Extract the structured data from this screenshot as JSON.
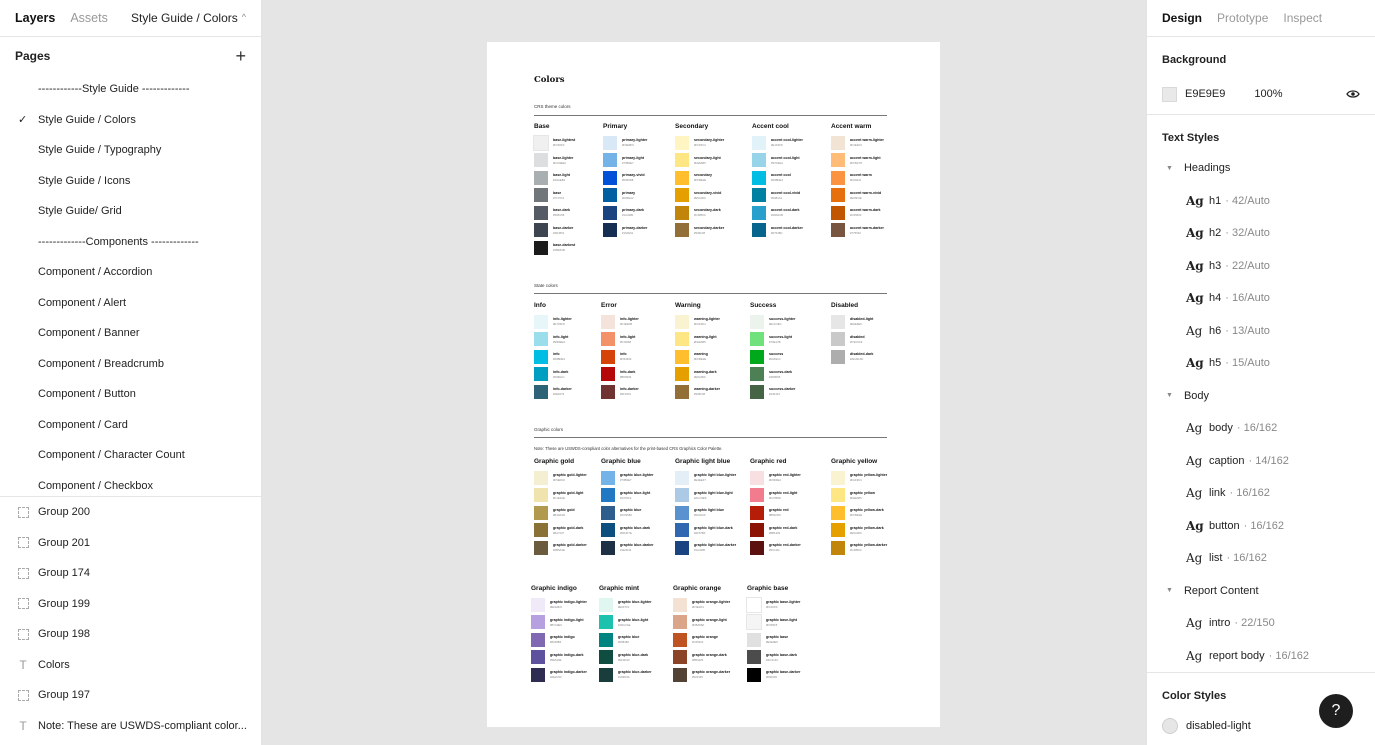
{
  "left_panel": {
    "tabs": [
      "Layers",
      "Assets"
    ],
    "file_breadcrumb": "Style Guide / Colors",
    "pages_heading": "Pages",
    "pages": [
      {
        "label": "------------Style Guide -------------",
        "selected": false
      },
      {
        "label": "Style Guide / Colors",
        "selected": true
      },
      {
        "label": "Style Guide / Typography",
        "selected": false
      },
      {
        "label": "Style Guide / Icons",
        "selected": false
      },
      {
        "label": "Style Guide/ Grid",
        "selected": false
      },
      {
        "label": "-------------Components -------------",
        "selected": false
      },
      {
        "label": "Component / Accordion",
        "selected": false
      },
      {
        "label": "Component / Alert",
        "selected": false
      },
      {
        "label": "Component / Banner",
        "selected": false
      },
      {
        "label": "Component / Breadcrumb",
        "selected": false
      },
      {
        "label": "Component / Button",
        "selected": false
      },
      {
        "label": "Component / Card",
        "selected": false
      },
      {
        "label": "Component / Character Count",
        "selected": false
      },
      {
        "label": "Component / Checkbox",
        "selected": false
      }
    ],
    "layers": [
      {
        "label": "Group 200",
        "kind": "group"
      },
      {
        "label": "Group 201",
        "kind": "group"
      },
      {
        "label": "Group 174",
        "kind": "group"
      },
      {
        "label": "Group 199",
        "kind": "group"
      },
      {
        "label": "Group 198",
        "kind": "group"
      },
      {
        "label": "Colors",
        "kind": "text"
      },
      {
        "label": "Group 197",
        "kind": "group"
      },
      {
        "label": "Note: These are USWDS-compliant color...",
        "kind": "text"
      }
    ]
  },
  "frame": {
    "title": "Colors",
    "sections": [
      {
        "label": "CRS theme colors"
      },
      {
        "label": "State colors"
      },
      {
        "label": "Graphic colors"
      }
    ],
    "note": "Note: These are USWDS-compliant color alternatives for the print-based CRS Graphics Color Palette.",
    "groups": [
      {
        "title": "Base",
        "section": 0,
        "swatches": [
          {
            "name": "base-lightest",
            "hex": "#F0F0F0",
            "color": "#f0f0f0"
          },
          {
            "name": "base-lighter",
            "hex": "#DCDEE0",
            "color": "#dcdee0"
          },
          {
            "name": "base-light",
            "hex": "#A9AEB1",
            "color": "#a9aeb1"
          },
          {
            "name": "base",
            "hex": "#71767A",
            "color": "#71767a"
          },
          {
            "name": "base-dark",
            "hex": "#565C65",
            "color": "#565c65"
          },
          {
            "name": "base-darker",
            "hex": "#3D4551",
            "color": "#3d4551"
          },
          {
            "name": "base-darkest",
            "hex": "#1B1B1B",
            "color": "#1b1b1b"
          }
        ]
      },
      {
        "title": "Primary",
        "section": 0,
        "swatches": [
          {
            "name": "primary-lighter",
            "hex": "#D9E8F6",
            "color": "#d9e8f6"
          },
          {
            "name": "primary-light",
            "hex": "#73B3E7",
            "color": "#73b3e7"
          },
          {
            "name": "primary-vivid",
            "hex": "#0050D8",
            "color": "#0050d8"
          },
          {
            "name": "primary",
            "hex": "#005EA2",
            "color": "#005ea2"
          },
          {
            "name": "primary-dark",
            "hex": "#1A4480",
            "color": "#1a4480"
          },
          {
            "name": "primary-darker",
            "hex": "#162E51",
            "color": "#162e51"
          }
        ]
      },
      {
        "title": "Secondary",
        "section": 0,
        "swatches": [
          {
            "name": "secondary-lighter",
            "hex": "#FFF5C2",
            "color": "#fff5c2"
          },
          {
            "name": "secondary-light",
            "hex": "#FEE685",
            "color": "#fee685"
          },
          {
            "name": "secondary",
            "hex": "#FFBE2E",
            "color": "#ffbe2e"
          },
          {
            "name": "secondary-vivid",
            "hex": "#E5A000",
            "color": "#e5a000"
          },
          {
            "name": "secondary-dark",
            "hex": "#C2850C",
            "color": "#c2850c"
          },
          {
            "name": "secondary-darker",
            "hex": "#936F38",
            "color": "#936f38"
          }
        ]
      },
      {
        "title": "Accent cool",
        "section": 0,
        "swatches": [
          {
            "name": "accent cool-lighter",
            "hex": "#E1F3F8",
            "color": "#e1f3f8"
          },
          {
            "name": "accent cool-light",
            "hex": "#97D4EA",
            "color": "#97d4ea"
          },
          {
            "name": "accent cool",
            "hex": "#00BDE3",
            "color": "#00bde3"
          },
          {
            "name": "accent cool-vivid",
            "hex": "#0081A1",
            "color": "#0081a1"
          },
          {
            "name": "accent cool-dark",
            "hex": "#28A0CB",
            "color": "#28a0cb"
          },
          {
            "name": "accent cool-darker",
            "hex": "#07648D",
            "color": "#07648d"
          }
        ]
      },
      {
        "title": "Accent warm",
        "section": 0,
        "swatches": [
          {
            "name": "accent warm-lighter",
            "hex": "#F2E4D4",
            "color": "#f2e4d4"
          },
          {
            "name": "accent warm-light",
            "hex": "#FFBC78",
            "color": "#ffbc78"
          },
          {
            "name": "accent warm",
            "hex": "#FA9441",
            "color": "#fa9441"
          },
          {
            "name": "accent warm-vivid",
            "hex": "#E66F0E",
            "color": "#e66f0e"
          },
          {
            "name": "accent warm-dark",
            "hex": "#C05600",
            "color": "#c05600"
          },
          {
            "name": "accent warm-darker",
            "hex": "#775540",
            "color": "#775540"
          }
        ]
      },
      {
        "title": "Info",
        "section": 1,
        "swatches": [
          {
            "name": "info-lighter",
            "hex": "#E7F6F8",
            "color": "#e7f6f8"
          },
          {
            "name": "info-light",
            "hex": "#99DEEA",
            "color": "#99deea"
          },
          {
            "name": "info",
            "hex": "#00BDE3",
            "color": "#00bde3"
          },
          {
            "name": "info-dark",
            "hex": "#009EC1",
            "color": "#009ec1"
          },
          {
            "name": "info-darker",
            "hex": "#2E6276",
            "color": "#2e6276"
          }
        ]
      },
      {
        "title": "Error",
        "section": 1,
        "swatches": [
          {
            "name": "info-lighter",
            "hex": "#F4E3DB",
            "color": "#f4e3db"
          },
          {
            "name": "info-light",
            "hex": "#F39268",
            "color": "#f39268"
          },
          {
            "name": "info",
            "hex": "#D54309",
            "color": "#d54309"
          },
          {
            "name": "info-dark",
            "hex": "#B50909",
            "color": "#b50909"
          },
          {
            "name": "info-darker",
            "hex": "#6F3331",
            "color": "#6f3331"
          }
        ]
      },
      {
        "title": "Warning",
        "section": 1,
        "swatches": [
          {
            "name": "warning-lighter",
            "hex": "#FAF3D1",
            "color": "#faf3d1"
          },
          {
            "name": "warning-light",
            "hex": "#FEE685",
            "color": "#fee685"
          },
          {
            "name": "warning",
            "hex": "#FFBE2E",
            "color": "#ffbe2e"
          },
          {
            "name": "warning-dark",
            "hex": "#E5A000",
            "color": "#e5a000"
          },
          {
            "name": "warning-darker",
            "hex": "#936F38",
            "color": "#936f38"
          }
        ]
      },
      {
        "title": "Success",
        "section": 1,
        "swatches": [
          {
            "name": "success-lighter",
            "hex": "#ECF3EC",
            "color": "#ecf3ec"
          },
          {
            "name": "success-light",
            "hex": "#70E17B",
            "color": "#70e17b"
          },
          {
            "name": "success",
            "hex": "#00A91C",
            "color": "#00a91c"
          },
          {
            "name": "success-dark",
            "hex": "#4D8055",
            "color": "#4d8055"
          },
          {
            "name": "success-darker",
            "hex": "#446443",
            "color": "#446443"
          }
        ]
      },
      {
        "title": "Disabled",
        "section": 1,
        "swatches": [
          {
            "name": "disabled-light",
            "hex": "#E6E6E6",
            "color": "#e6e6e6"
          },
          {
            "name": "disabled",
            "hex": "#C9C9C9",
            "color": "#c9c9c9"
          },
          {
            "name": "disabled-dark",
            "hex": "#ADADAD",
            "color": "#adadad"
          }
        ]
      },
      {
        "title": "Graphic gold",
        "section": 2,
        "swatches": [
          {
            "name": "graphic gold-lighter",
            "hex": "#F5EFD2",
            "color": "#f5efd2"
          },
          {
            "name": "graphic gold-light",
            "hex": "#F1E3AE",
            "color": "#f1e3ae"
          },
          {
            "name": "graphic gold",
            "hex": "#B19A4D",
            "color": "#b19a4d"
          },
          {
            "name": "graphic gold-dark",
            "hex": "#8A7237",
            "color": "#8a7237"
          },
          {
            "name": "graphic gold-darker",
            "hex": "#6B5A3E",
            "color": "#6b5a3e"
          }
        ]
      },
      {
        "title": "Graphic blue",
        "section": 2,
        "swatches": [
          {
            "name": "graphic blue-lighter",
            "hex": "#73B3E7",
            "color": "#73b3e7"
          },
          {
            "name": "graphic blue-light",
            "hex": "#2378C3",
            "color": "#2378c3"
          },
          {
            "name": "graphic blue",
            "hex": "#2C5D8C",
            "color": "#2c5d8c"
          },
          {
            "name": "graphic blue-dark",
            "hex": "#0D4F7E",
            "color": "#0d4f7e"
          },
          {
            "name": "graphic blue-darker",
            "hex": "#1E3044",
            "color": "#1e3044"
          }
        ]
      },
      {
        "title": "Graphic light blue",
        "section": 2,
        "swatches": [
          {
            "name": "graphic light blue-lighter",
            "hex": "#E3EEF7",
            "color": "#e3eef7"
          },
          {
            "name": "graphic light blue-light",
            "hex": "#ACC9E6",
            "color": "#acc9e6"
          },
          {
            "name": "graphic light blue",
            "hex": "#5A91CF",
            "color": "#5a91cf"
          },
          {
            "name": "graphic light blue-dark",
            "hex": "#2F67B0",
            "color": "#2f67b0"
          },
          {
            "name": "graphic light blue-darker",
            "hex": "#1A4480",
            "color": "#1a4480"
          }
        ]
      },
      {
        "title": "Graphic red",
        "section": 2,
        "swatches": [
          {
            "name": "graphic red-lighter",
            "hex": "#F8DFE2",
            "color": "#f8dfe2"
          },
          {
            "name": "graphic red-light",
            "hex": "#F27B8D",
            "color": "#f27b8d"
          },
          {
            "name": "graphic red",
            "hex": "#B51D09",
            "color": "#b51d09"
          },
          {
            "name": "graphic red-dark",
            "hex": "#8B1303",
            "color": "#8b1303"
          },
          {
            "name": "graphic red-darker",
            "hex": "#5C1111",
            "color": "#5c1111"
          }
        ]
      },
      {
        "title": "Graphic yellow",
        "section": 2,
        "swatches": [
          {
            "name": "graphic yellow-lighter",
            "hex": "#FAF3D1",
            "color": "#faf3d1"
          },
          {
            "name": "graphic yellow",
            "hex": "#FEE685",
            "color": "#fee685"
          },
          {
            "name": "graphic yellow-dark",
            "hex": "#FFBE2E",
            "color": "#ffbe2e"
          },
          {
            "name": "graphic yellow-dark",
            "hex": "#E5A000",
            "color": "#e5a000"
          },
          {
            "name": "graphic yellow-darker",
            "hex": "#C2850C",
            "color": "#c2850c"
          }
        ]
      },
      {
        "title": "Graphic indigo",
        "section": 3,
        "swatches": [
          {
            "name": "graphic indigo-lighter",
            "hex": "#EFE9F8",
            "color": "#efe9f8"
          },
          {
            "name": "graphic indigo-light",
            "hex": "#B7A0E0",
            "color": "#b7a0e0"
          },
          {
            "name": "graphic indigo",
            "hex": "#8168B3",
            "color": "#8168b3"
          },
          {
            "name": "graphic indigo-dark",
            "hex": "#5E519E",
            "color": "#5e519e"
          },
          {
            "name": "graphic indigo-darker",
            "hex": "#2E2C50",
            "color": "#2e2c50"
          }
        ]
      },
      {
        "title": "Graphic mint",
        "section": 3,
        "swatches": [
          {
            "name": "graphic blue-lighter",
            "hex": "#E0F7F1",
            "color": "#e0f7f1"
          },
          {
            "name": "graphic blue-light",
            "hex": "#1DC2AE",
            "color": "#1dc2ae"
          },
          {
            "name": "graphic blue",
            "hex": "#008480",
            "color": "#008480"
          },
          {
            "name": "graphic blue-dark",
            "hex": "#0F4D40",
            "color": "#0f4d40"
          },
          {
            "name": "graphic blue-darker",
            "hex": "#193D3A",
            "color": "#193d3a"
          }
        ]
      },
      {
        "title": "Graphic orange",
        "section": 3,
        "swatches": [
          {
            "name": "graphic orange-lighter",
            "hex": "#F3E1D4",
            "color": "#f3e1d4"
          },
          {
            "name": "graphic orange-light",
            "hex": "#DBA58A",
            "color": "#dba58a"
          },
          {
            "name": "graphic orange",
            "hex": "#C05322",
            "color": "#c05322"
          },
          {
            "name": "graphic orange-dark",
            "hex": "#8B4425",
            "color": "#8b4425"
          },
          {
            "name": "graphic orange-darker",
            "hex": "#524336",
            "color": "#524336"
          }
        ]
      },
      {
        "title": "Graphic base",
        "section": 3,
        "swatches": [
          {
            "name": "graphic base-lighter",
            "hex": "#FFFFFF",
            "color": "#ffffff"
          },
          {
            "name": "graphic base-light",
            "hex": "#F5F5F5",
            "color": "#f5f5f5"
          },
          {
            "name": "graphic base",
            "hex": "#E0E0E0",
            "color": "#e0e0e0"
          },
          {
            "name": "graphic base-dark",
            "hex": "#4C4C4C",
            "color": "#4c4c4c"
          },
          {
            "name": "graphic base-darker",
            "hex": "#000000",
            "color": "#000000"
          }
        ]
      }
    ]
  },
  "right_panel": {
    "tabs": [
      "Design",
      "Prototype",
      "Inspect"
    ],
    "background": {
      "title": "Background",
      "hex": "E9E9E9",
      "opacity": "100%",
      "color": "#e9e9e9"
    },
    "text_styles": {
      "title": "Text Styles",
      "groups": [
        {
          "label": "Headings",
          "items": [
            {
              "name": "h1",
              "meta": "· 42/Auto",
              "bold": true
            },
            {
              "name": "h2",
              "meta": "· 32/Auto",
              "bold": true
            },
            {
              "name": "h3",
              "meta": "· 22/Auto",
              "bold": true
            },
            {
              "name": "h4",
              "meta": "· 16/Auto",
              "bold": true
            },
            {
              "name": "h6",
              "meta": "· 13/Auto",
              "bold": false
            },
            {
              "name": "h5",
              "meta": "· 15/Auto",
              "bold": true
            }
          ]
        },
        {
          "label": "Body",
          "items": [
            {
              "name": "body",
              "meta": "· 16/162",
              "bold": false
            },
            {
              "name": "caption",
              "meta": "· 14/162",
              "bold": false
            },
            {
              "name": "link",
              "meta": "· 16/162",
              "bold": false
            },
            {
              "name": "button",
              "meta": "· 16/162",
              "bold": true
            },
            {
              "name": "list",
              "meta": "· 16/162",
              "bold": false
            }
          ]
        },
        {
          "label": "Report Content",
          "items": [
            {
              "name": "intro",
              "meta": "· 22/150",
              "bold": false
            },
            {
              "name": "report body",
              "meta": "· 16/162",
              "bold": false
            }
          ]
        }
      ]
    },
    "color_styles": {
      "title": "Color Styles",
      "items": [
        {
          "name": "disabled-light"
        }
      ]
    },
    "help_label": "?"
  }
}
